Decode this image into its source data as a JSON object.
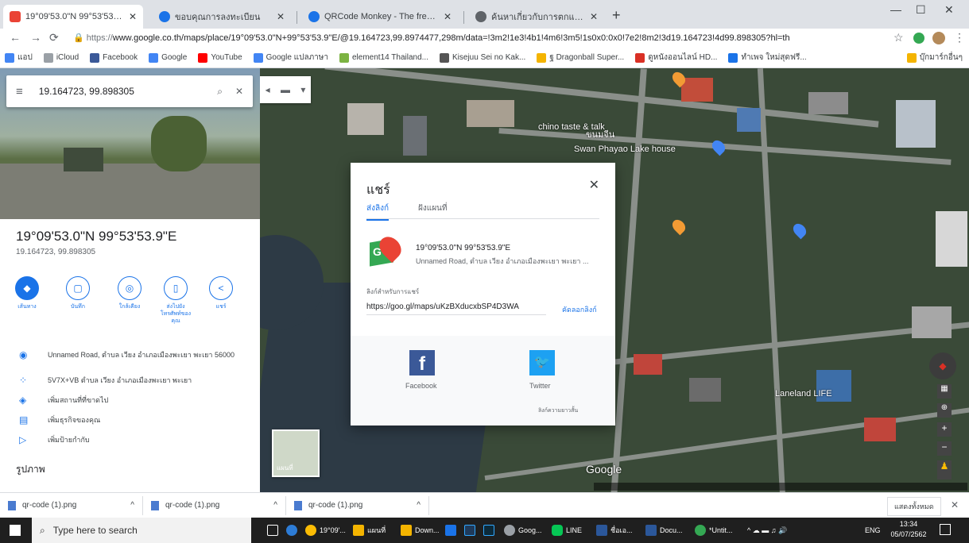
{
  "tabs": [
    {
      "title": "19°09'53.0\"N 99°53'53.9\"E - Goo",
      "color": "#ea4335"
    },
    {
      "title": "ขอบคุณการลงทะเบียน",
      "color": "#1a73e8"
    },
    {
      "title": "QRCode Monkey - The free QR C",
      "color": "#1a73e8"
    },
    {
      "title": "ค้นหาเกี่ยวกับการตกแต่งบ้าน",
      "color": "#5f6368"
    }
  ],
  "address": {
    "url_prefix": "https://",
    "url": "www.google.co.th/maps/place/19°09'53.0\"N+99°53'53.9\"E/@19.164723,99.8974477,298m/data=!3m2!1e3!4b1!4m6!3m5!1s0x0:0x0!7e2!8m2!3d19.164723!4d99.898305?hl=th"
  },
  "bookmarks": [
    {
      "label": "แอป",
      "color": "#4285f4"
    },
    {
      "label": "iCloud",
      "color": "#9aa0a6"
    },
    {
      "label": "Facebook",
      "color": "#3b5998"
    },
    {
      "label": "Google",
      "color": "#4285f4"
    },
    {
      "label": "YouTube",
      "color": "#ff0000"
    },
    {
      "label": "Google แปลภาษา",
      "color": "#4285f4"
    },
    {
      "label": "element14 Thailand...",
      "color": "#7cb342"
    },
    {
      "label": "Kisejuu Sei no Kak...",
      "color": "#555555"
    },
    {
      "label": "ฐ Dragonball Super...",
      "color": "#f4b400"
    },
    {
      "label": "ดูหนังออนไลน์ HD...",
      "color": "#d93025"
    },
    {
      "label": "ทำเพจ ใหม่สุดฟรี...",
      "color": "#1a73e8"
    },
    {
      "label": "บุ๊กมาร์กอื่นๆ",
      "color": "#f4b400"
    }
  ],
  "panel": {
    "search_value": "19.164723, 99.898305",
    "coord_title": "19°09'53.0\"N 99°53'53.9\"E",
    "coord_decimal": "19.164723, 99.898305",
    "actions": [
      "เส้นทาง",
      "บันทึก",
      "ใกล้เคียง",
      "ส่งไปยังโทรศัพท์ของคุณ",
      "แชร์"
    ],
    "rows": [
      "Unnamed Road, ตำบล เวียง อำเภอเมืองพะเยา พะเยา 56000",
      "5V7X+VB ตำบล เวียง อำเภอเมืองพะเยา พะเยา",
      "เพิ่มสถานที่ที่ขาดไป",
      "เพิ่มธุรกิจของคุณ",
      "เพิ่มป้ายกำกับ"
    ],
    "photos_label": "รูปภาพ"
  },
  "map": {
    "labels": [
      "ขนมจีน",
      "chino taste & talk",
      "Swan Phayao Lake house",
      "Laneland LIFE",
      "Google"
    ],
    "thumb_label": "แผนที่"
  },
  "dialog": {
    "title": "แชร์",
    "tab_send": "ส่งลิงก์",
    "tab_embed": "ฝังแผนที่",
    "place_title": "19°09'53.0\"N 99°53'53.9\"E",
    "place_sub": "Unnamed Road, ตำบล เวียง อำเภอเมืองพะเยา พะเยา ...",
    "link_label": "ลิงก์สำหรับการแชร์",
    "link_value": "https://goo.gl/maps/uKzBXducxbSP4D3WA",
    "copy_label": "คัดลอกลิงก์",
    "facebook": "Facebook",
    "twitter": "Twitter",
    "shorten_label": "ลิงก์ความยาวสั้น"
  },
  "downloads": [
    "qr-code (1).png",
    "qr-code (1).png",
    "qr-code (1).png"
  ],
  "downloads_show_all": "แสดงทั้งหมด",
  "taskbar": {
    "search": "Type here to search",
    "apps": [
      "19°09'...",
      "แผนที่",
      "Down...",
      "",
      "",
      "",
      "Goog...",
      "LINE",
      "ชื่อเอ...",
      "Docu...",
      "*Untit..."
    ],
    "lang": "ENG",
    "time": "13:34",
    "date": "05/07/2562"
  }
}
